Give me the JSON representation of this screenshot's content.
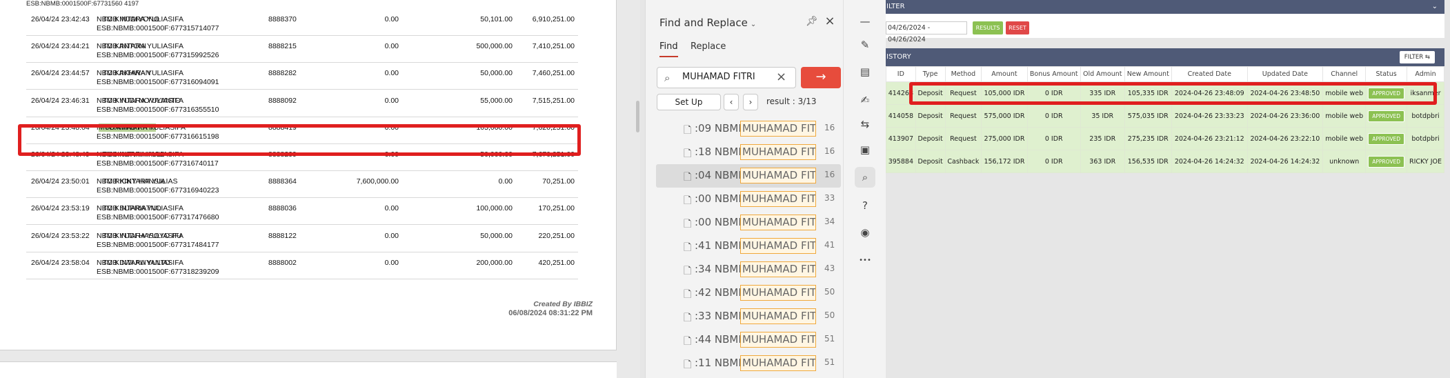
{
  "document": {
    "top_partial": "ESB:NBMB:0001500F:67731560 4197",
    "rows": [
      {
        "date": "26/04/24 23:42:43",
        "from": "NBMB MUDIYONO",
        "to": "TO KINTARA YULIASIFA",
        "desc2": "ESB:NBMB:0001500F:677315714077",
        "ref": "8888370",
        "debit": "0.00",
        "credit": "50,101.00",
        "balance": "6,910,251.00"
      },
      {
        "date": "26/04/24 23:44:21",
        "from": "NBMB ANTONI",
        "to": "TO KINTARA YULIASIFA",
        "desc2": "ESB:NBMB:0001500F:677315992526",
        "ref": "8888215",
        "debit": "0.00",
        "credit": "500,000.00",
        "balance": "7,410,251.00"
      },
      {
        "date": "26/04/24 23:44:57",
        "from": "NBMB AKHWAN",
        "to": "TO KINTARA YULIASIFA",
        "desc2": "ESB:NBMB:0001500F:677316094091",
        "ref": "8888282",
        "debit": "0.00",
        "credit": "50,000.00",
        "balance": "7,460,251.00"
      },
      {
        "date": "26/04/24 23:46:31",
        "from": "NBMB YUDI NOVIYANTO",
        "to": "TO KINTARA YULIASIFA",
        "desc2": "ESB:NBMB:0001500F:677316355510",
        "ref": "8888092",
        "debit": "0.00",
        "credit": "55,000.00",
        "balance": "7,515,251.00"
      },
      {
        "date": "26/04/24 23:48:04",
        "from": "NBMB",
        "from_highlight": "MUHAMAD FITRI",
        "to": "TO KINTARA YULIASIFA",
        "desc2": "ESB:NBMB:0001500F:677316615198",
        "ref": "8888419",
        "debit": "0.00",
        "credit": "105,000.00",
        "balance": "7,620,251.00"
      },
      {
        "date": "26/04/24 23:48:49",
        "from": "NBMB NUR KHAMID",
        "to": "TO KINTARA YULIASIFA",
        "desc2": "ESB:NBMB:0001500F:677316740117",
        "ref": "8888299",
        "debit": "0.00",
        "credit": "50,000.00",
        "balance": "7,670,251.00"
      },
      {
        "date": "26/04/24 23:50:01",
        "from": "NBMB KINTARA YULIAS",
        "to": "TO RICKY HANSIA",
        "desc2": "ESB:NBMB:0001500F:677316940223",
        "ref": "8888364",
        "debit": "7,600,000.00",
        "credit": "0.00",
        "balance": "70,251.00"
      },
      {
        "date": "26/04/24 23:53:19",
        "from": "NBMB SUPRIATNO",
        "to": "TO KINTARA YULIASIFA",
        "desc2": "ESB:NBMB:0001500F:677317476680",
        "ref": "8888036",
        "debit": "0.00",
        "credit": "100,000.00",
        "balance": "170,251.00"
      },
      {
        "date": "26/04/24 23:53:22",
        "from": "NBMB YUDI HASOYO PU",
        "to": "TO KINTARA YULIASIFA",
        "desc2": "ESB:NBMB:0001500F:677317484177",
        "ref": "8888122",
        "debit": "0.00",
        "credit": "50,000.00",
        "balance": "220,251.00"
      },
      {
        "date": "26/04/24 23:58:04",
        "from": "NBMB DWI ALIYANTO",
        "to": "TO KINTARA YULIASIFA",
        "desc2": "ESB:NBMB:0001500F:677318239209",
        "ref": "8888002",
        "debit": "0.00",
        "credit": "200,000.00",
        "balance": "420,251.00"
      }
    ],
    "created_by": "Created By IBBIZ",
    "created_date": "06/08/2024 08:31:22 PM"
  },
  "find": {
    "title": "Find and Replace",
    "tab_find": "Find",
    "tab_replace": "Replace",
    "query": "MUHAMAD FITRI",
    "setup_label": "Set Up",
    "result_count": "result : 3/13",
    "results": [
      {
        "pre": ":09 NBMB",
        "match": "MUHAMAD FITR",
        "page": "16"
      },
      {
        "pre": ":18 NBMB",
        "match": "MUHAMAD FITR",
        "page": "16"
      },
      {
        "pre": ":04 NBMB",
        "match": "MUHAMAD FITR",
        "page": "16"
      },
      {
        "pre": ":00 NBMB",
        "match": "MUHAMAD FITR",
        "page": "33"
      },
      {
        "pre": ":00 NBMB",
        "match": "MUHAMAD FITR",
        "page": "34"
      },
      {
        "pre": ":41 NBMB",
        "match": "MUHAMAD FITR",
        "page": "41"
      },
      {
        "pre": ":34 NBMB",
        "match": "MUHAMAD FITR",
        "page": "43"
      },
      {
        "pre": ":42 NBMB",
        "match": "MUHAMAD FITR",
        "page": "50"
      },
      {
        "pre": ":33 NBMB",
        "match": "MUHAMAD FITR",
        "page": "50"
      },
      {
        "pre": ":44 NBMB",
        "match": "MUHAMAD FITR",
        "page": "51"
      },
      {
        "pre": ":11 NBMB",
        "match": "MUHAMAD FITR",
        "page": "51"
      }
    ]
  },
  "tools": [
    {
      "name": "minus-tool-icon",
      "glyph": "—"
    },
    {
      "name": "edit-icon",
      "glyph": "✎"
    },
    {
      "name": "document-edit-icon",
      "glyph": "▤"
    },
    {
      "name": "sign-icon",
      "glyph": "✍"
    },
    {
      "name": "compare-icon",
      "glyph": "⇆"
    },
    {
      "name": "form-icon",
      "glyph": "▣"
    },
    {
      "name": "search-tool-icon",
      "glyph": "⌕"
    },
    {
      "name": "help-icon",
      "glyph": "?"
    },
    {
      "name": "accessibility-icon",
      "glyph": "◉"
    },
    {
      "name": "more-icon",
      "glyph": "•••"
    }
  ],
  "admin": {
    "filter_title": "ILTER",
    "date_range": "04/26/2024 - 04/26/2024",
    "results_label": "RESULTS",
    "reset_label": "RESET",
    "history_title": "ISTORY",
    "filter_button": "FILTER ⇆",
    "columns": [
      "ID",
      "Type",
      "Method",
      "Amount",
      "Bonus Amount",
      "Old Amount",
      "New Amount",
      "Created Date",
      "Updated Date",
      "Channel",
      "Status",
      "Admin"
    ],
    "rows": [
      {
        "id": "414268",
        "type": "Deposit",
        "method": "Request",
        "amount": "105,000 IDR",
        "bonus": "0 IDR",
        "old": "335 IDR",
        "new": "105,335 IDR",
        "created": "2024-04-26 23:48:09",
        "updated": "2024-04-26 23:48:50",
        "channel": "mobile web",
        "status": "APPROVED",
        "admin": "iksanmer"
      },
      {
        "id": "414058",
        "type": "Deposit",
        "method": "Request",
        "amount": "575,000 IDR",
        "bonus": "0 IDR",
        "old": "35 IDR",
        "new": "575,035 IDR",
        "created": "2024-04-26 23:33:23",
        "updated": "2024-04-26 23:36:00",
        "channel": "mobile web",
        "status": "APPROVED",
        "admin": "botdpbri"
      },
      {
        "id": "413907",
        "type": "Deposit",
        "method": "Request",
        "amount": "275,000 IDR",
        "bonus": "0 IDR",
        "old": "235 IDR",
        "new": "275,235 IDR",
        "created": "2024-04-26 23:21:12",
        "updated": "2024-04-26 23:22:10",
        "channel": "mobile web",
        "status": "APPROVED",
        "admin": "botdpbri"
      },
      {
        "id": "395884",
        "type": "Deposit",
        "method": "Cashback",
        "amount": "156,172 IDR",
        "bonus": "0 IDR",
        "old": "363 IDR",
        "new": "156,535 IDR",
        "created": "2024-04-26 14:24:32",
        "updated": "2024-04-26 14:24:32",
        "channel": "unknown",
        "status": "APPROVED",
        "admin": "RICKY JOE"
      }
    ]
  },
  "colors": {
    "highlight_box": "#e01f1f",
    "accent": "#e74c3c",
    "approved": "#8cc152",
    "header_bar": "#4f5a77",
    "row_green": "#dff0cf"
  }
}
